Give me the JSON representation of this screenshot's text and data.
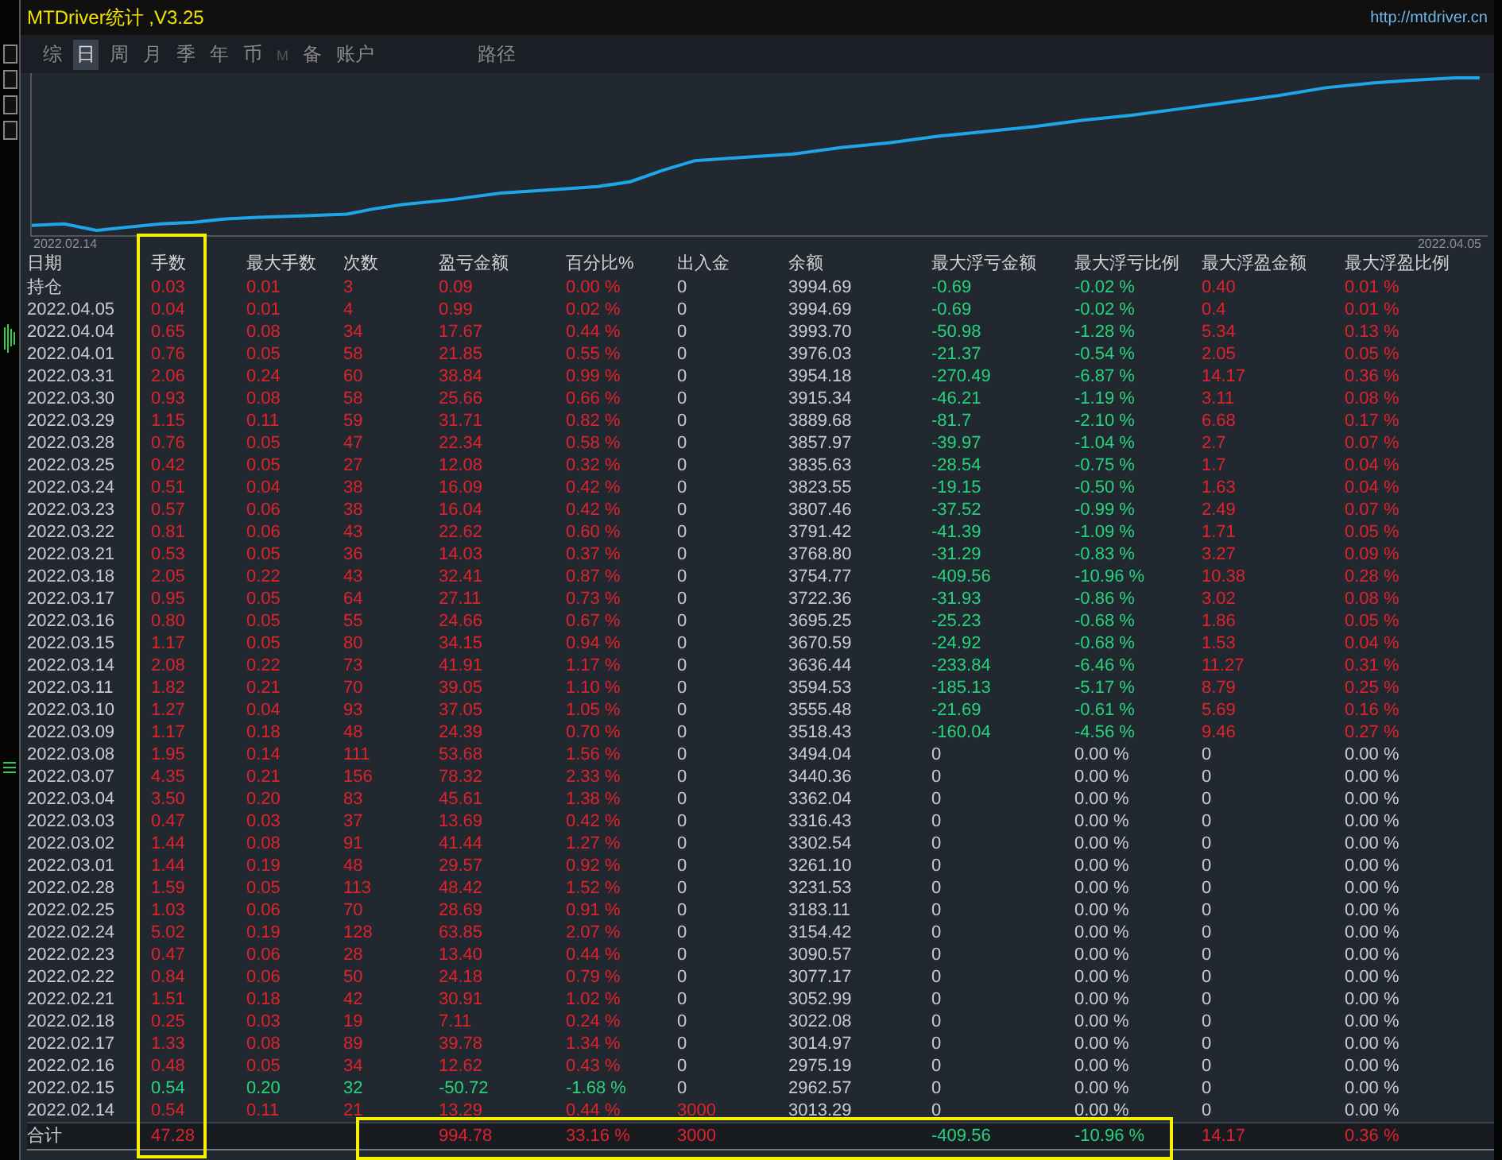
{
  "window": {
    "title": "MTDriver统计 ,V3.25",
    "link": "http://mtdriver.cn"
  },
  "tabs": [
    {
      "label": "综",
      "selected": false,
      "disabled": false
    },
    {
      "label": "日",
      "selected": true,
      "disabled": false
    },
    {
      "label": "周",
      "selected": false,
      "disabled": false
    },
    {
      "label": "月",
      "selected": false,
      "disabled": false
    },
    {
      "label": "季",
      "selected": false,
      "disabled": false
    },
    {
      "label": "年",
      "selected": false,
      "disabled": false
    },
    {
      "label": "币",
      "selected": false,
      "disabled": false
    },
    {
      "label": "M",
      "selected": false,
      "disabled": true
    },
    {
      "label": "备",
      "selected": false,
      "disabled": false
    },
    {
      "label": "账户",
      "selected": false,
      "disabled": false
    },
    {
      "label": "路径",
      "selected": false,
      "disabled": false
    }
  ],
  "chart": {
    "start_label": "2022.02.14",
    "end_label": "2022.04.05"
  },
  "table": {
    "columns": [
      "日期",
      "手数",
      "最大手数",
      "次数",
      "盈亏金额",
      "百分比%",
      "出入金",
      "余额",
      "最大浮亏金额",
      "最大浮亏比例",
      "最大浮盈金额",
      "最大浮盈比例"
    ],
    "rows": [
      {
        "loss": false,
        "float": true,
        "cells": [
          "持仓",
          "0.03",
          "0.01",
          "3",
          "0.09",
          "0.00 %",
          "0",
          "3994.69",
          "-0.69",
          "-0.02 %",
          "0.40",
          "0.01 %"
        ]
      },
      {
        "loss": false,
        "float": true,
        "cells": [
          "2022.04.05",
          "0.04",
          "0.01",
          "4",
          "0.99",
          "0.02 %",
          "0",
          "3994.69",
          "-0.69",
          "-0.02 %",
          "0.4",
          "0.01 %"
        ]
      },
      {
        "loss": false,
        "float": true,
        "cells": [
          "2022.04.04",
          "0.65",
          "0.08",
          "34",
          "17.67",
          "0.44 %",
          "0",
          "3993.70",
          "-50.98",
          "-1.28 %",
          "5.34",
          "0.13 %"
        ]
      },
      {
        "loss": false,
        "float": true,
        "cells": [
          "2022.04.01",
          "0.76",
          "0.05",
          "58",
          "21.85",
          "0.55 %",
          "0",
          "3976.03",
          "-21.37",
          "-0.54 %",
          "2.05",
          "0.05 %"
        ]
      },
      {
        "loss": false,
        "float": true,
        "cells": [
          "2022.03.31",
          "2.06",
          "0.24",
          "60",
          "38.84",
          "0.99 %",
          "0",
          "3954.18",
          "-270.49",
          "-6.87 %",
          "14.17",
          "0.36 %"
        ]
      },
      {
        "loss": false,
        "float": true,
        "cells": [
          "2022.03.30",
          "0.93",
          "0.08",
          "58",
          "25.66",
          "0.66 %",
          "0",
          "3915.34",
          "-46.21",
          "-1.19 %",
          "3.11",
          "0.08 %"
        ]
      },
      {
        "loss": false,
        "float": true,
        "cells": [
          "2022.03.29",
          "1.15",
          "0.11",
          "59",
          "31.71",
          "0.82 %",
          "0",
          "3889.68",
          "-81.7",
          "-2.10 %",
          "6.68",
          "0.17 %"
        ]
      },
      {
        "loss": false,
        "float": true,
        "cells": [
          "2022.03.28",
          "0.76",
          "0.05",
          "47",
          "22.34",
          "0.58 %",
          "0",
          "3857.97",
          "-39.97",
          "-1.04 %",
          "2.7",
          "0.07 %"
        ]
      },
      {
        "loss": false,
        "float": true,
        "cells": [
          "2022.03.25",
          "0.42",
          "0.05",
          "27",
          "12.08",
          "0.32 %",
          "0",
          "3835.63",
          "-28.54",
          "-0.75 %",
          "1.7",
          "0.04 %"
        ]
      },
      {
        "loss": false,
        "float": true,
        "cells": [
          "2022.03.24",
          "0.51",
          "0.04",
          "38",
          "16.09",
          "0.42 %",
          "0",
          "3823.55",
          "-19.15",
          "-0.50 %",
          "1.63",
          "0.04 %"
        ]
      },
      {
        "loss": false,
        "float": true,
        "cells": [
          "2022.03.23",
          "0.57",
          "0.06",
          "38",
          "16.04",
          "0.42 %",
          "0",
          "3807.46",
          "-37.52",
          "-0.99 %",
          "2.49",
          "0.07 %"
        ]
      },
      {
        "loss": false,
        "float": true,
        "cells": [
          "2022.03.22",
          "0.81",
          "0.06",
          "43",
          "22.62",
          "0.60 %",
          "0",
          "3791.42",
          "-41.39",
          "-1.09 %",
          "1.71",
          "0.05 %"
        ]
      },
      {
        "loss": false,
        "float": true,
        "cells": [
          "2022.03.21",
          "0.53",
          "0.05",
          "36",
          "14.03",
          "0.37 %",
          "0",
          "3768.80",
          "-31.29",
          "-0.83 %",
          "3.27",
          "0.09 %"
        ]
      },
      {
        "loss": false,
        "float": true,
        "cells": [
          "2022.03.18",
          "2.05",
          "0.22",
          "43",
          "32.41",
          "0.87 %",
          "0",
          "3754.77",
          "-409.56",
          "-10.96 %",
          "10.38",
          "0.28 %"
        ]
      },
      {
        "loss": false,
        "float": true,
        "cells": [
          "2022.03.17",
          "0.95",
          "0.05",
          "64",
          "27.11",
          "0.73 %",
          "0",
          "3722.36",
          "-31.93",
          "-0.86 %",
          "3.02",
          "0.08 %"
        ]
      },
      {
        "loss": false,
        "float": true,
        "cells": [
          "2022.03.16",
          "0.80",
          "0.05",
          "55",
          "24.66",
          "0.67 %",
          "0",
          "3695.25",
          "-25.23",
          "-0.68 %",
          "1.86",
          "0.05 %"
        ]
      },
      {
        "loss": false,
        "float": true,
        "cells": [
          "2022.03.15",
          "1.17",
          "0.05",
          "80",
          "34.15",
          "0.94 %",
          "0",
          "3670.59",
          "-24.92",
          "-0.68 %",
          "1.53",
          "0.04 %"
        ]
      },
      {
        "loss": false,
        "float": true,
        "cells": [
          "2022.03.14",
          "2.08",
          "0.22",
          "73",
          "41.91",
          "1.17 %",
          "0",
          "3636.44",
          "-233.84",
          "-6.46 %",
          "11.27",
          "0.31 %"
        ]
      },
      {
        "loss": false,
        "float": true,
        "cells": [
          "2022.03.11",
          "1.82",
          "0.21",
          "70",
          "39.05",
          "1.10 %",
          "0",
          "3594.53",
          "-185.13",
          "-5.17 %",
          "8.79",
          "0.25 %"
        ]
      },
      {
        "loss": false,
        "float": true,
        "cells": [
          "2022.03.10",
          "1.27",
          "0.04",
          "93",
          "37.05",
          "1.05 %",
          "0",
          "3555.48",
          "-21.69",
          "-0.61 %",
          "5.69",
          "0.16 %"
        ]
      },
      {
        "loss": false,
        "float": true,
        "cells": [
          "2022.03.09",
          "1.17",
          "0.18",
          "48",
          "24.39",
          "0.70 %",
          "0",
          "3518.43",
          "-160.04",
          "-4.56 %",
          "9.46",
          "0.27 %"
        ]
      },
      {
        "loss": false,
        "float": false,
        "cells": [
          "2022.03.08",
          "1.95",
          "0.14",
          "111",
          "53.68",
          "1.56 %",
          "0",
          "3494.04",
          "0",
          "0.00 %",
          "0",
          "0.00 %"
        ]
      },
      {
        "loss": false,
        "float": false,
        "cells": [
          "2022.03.07",
          "4.35",
          "0.21",
          "156",
          "78.32",
          "2.33 %",
          "0",
          "3440.36",
          "0",
          "0.00 %",
          "0",
          "0.00 %"
        ]
      },
      {
        "loss": false,
        "float": false,
        "cells": [
          "2022.03.04",
          "3.50",
          "0.20",
          "83",
          "45.61",
          "1.38 %",
          "0",
          "3362.04",
          "0",
          "0.00 %",
          "0",
          "0.00 %"
        ]
      },
      {
        "loss": false,
        "float": false,
        "cells": [
          "2022.03.03",
          "0.47",
          "0.03",
          "37",
          "13.69",
          "0.42 %",
          "0",
          "3316.43",
          "0",
          "0.00 %",
          "0",
          "0.00 %"
        ]
      },
      {
        "loss": false,
        "float": false,
        "cells": [
          "2022.03.02",
          "1.44",
          "0.08",
          "91",
          "41.44",
          "1.27 %",
          "0",
          "3302.54",
          "0",
          "0.00 %",
          "0",
          "0.00 %"
        ]
      },
      {
        "loss": false,
        "float": false,
        "cells": [
          "2022.03.01",
          "1.44",
          "0.19",
          "48",
          "29.57",
          "0.92 %",
          "0",
          "3261.10",
          "0",
          "0.00 %",
          "0",
          "0.00 %"
        ]
      },
      {
        "loss": false,
        "float": false,
        "cells": [
          "2022.02.28",
          "1.59",
          "0.05",
          "113",
          "48.42",
          "1.52 %",
          "0",
          "3231.53",
          "0",
          "0.00 %",
          "0",
          "0.00 %"
        ]
      },
      {
        "loss": false,
        "float": false,
        "cells": [
          "2022.02.25",
          "1.03",
          "0.06",
          "70",
          "28.69",
          "0.91 %",
          "0",
          "3183.11",
          "0",
          "0.00 %",
          "0",
          "0.00 %"
        ]
      },
      {
        "loss": false,
        "float": false,
        "cells": [
          "2022.02.24",
          "5.02",
          "0.19",
          "128",
          "63.85",
          "2.07 %",
          "0",
          "3154.42",
          "0",
          "0.00 %",
          "0",
          "0.00 %"
        ]
      },
      {
        "loss": false,
        "float": false,
        "cells": [
          "2022.02.23",
          "0.47",
          "0.06",
          "28",
          "13.40",
          "0.44 %",
          "0",
          "3090.57",
          "0",
          "0.00 %",
          "0",
          "0.00 %"
        ]
      },
      {
        "loss": false,
        "float": false,
        "cells": [
          "2022.02.22",
          "0.84",
          "0.06",
          "50",
          "24.18",
          "0.79 %",
          "0",
          "3077.17",
          "0",
          "0.00 %",
          "0",
          "0.00 %"
        ]
      },
      {
        "loss": false,
        "float": false,
        "cells": [
          "2022.02.21",
          "1.51",
          "0.18",
          "42",
          "30.91",
          "1.02 %",
          "0",
          "3052.99",
          "0",
          "0.00 %",
          "0",
          "0.00 %"
        ]
      },
      {
        "loss": false,
        "float": false,
        "cells": [
          "2022.02.18",
          "0.25",
          "0.03",
          "19",
          "7.11",
          "0.24 %",
          "0",
          "3022.08",
          "0",
          "0.00 %",
          "0",
          "0.00 %"
        ]
      },
      {
        "loss": false,
        "float": false,
        "cells": [
          "2022.02.17",
          "1.33",
          "0.08",
          "89",
          "39.78",
          "1.34 %",
          "0",
          "3014.97",
          "0",
          "0.00 %",
          "0",
          "0.00 %"
        ]
      },
      {
        "loss": false,
        "float": false,
        "cells": [
          "2022.02.16",
          "0.48",
          "0.05",
          "34",
          "12.62",
          "0.43 %",
          "0",
          "2975.19",
          "0",
          "0.00 %",
          "0",
          "0.00 %"
        ]
      },
      {
        "loss": true,
        "float": false,
        "cells": [
          "2022.02.15",
          "0.54",
          "0.20",
          "32",
          "-50.72",
          "-1.68 %",
          "0",
          "2962.57",
          "0",
          "0.00 %",
          "0",
          "0.00 %"
        ]
      },
      {
        "loss": false,
        "float": false,
        "cells": [
          "2022.02.14",
          "0.54",
          "0.11",
          "21",
          "13.29",
          "0.44 %",
          "3000",
          "3013.29",
          "0",
          "0.00 %",
          "0",
          "0.00 %"
        ]
      }
    ],
    "total": {
      "label": "合计",
      "lots": "47.28",
      "pnl": "994.78",
      "percent": "33.16 %",
      "deposit": "3000",
      "max_float_loss": "-409.56",
      "max_float_loss_ratio": "-10.96 %",
      "max_float_profit": "14.17",
      "max_float_profit_ratio": "0.36 %"
    }
  }
}
